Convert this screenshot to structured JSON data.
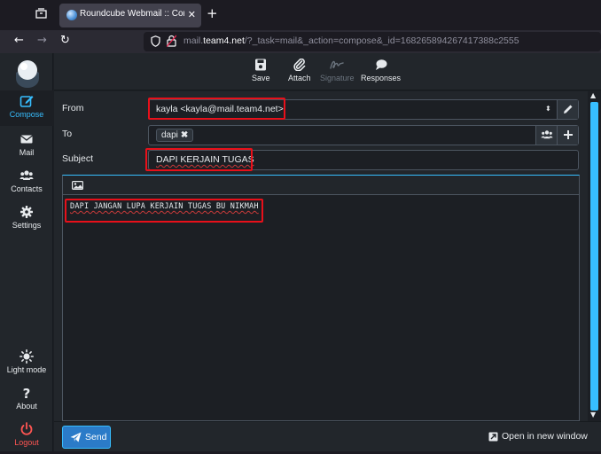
{
  "browser": {
    "tab_title": "Roundcube Webmail :: Compo",
    "url_host": "mail.team4.net",
    "url_path": "/?_task=mail&_action=compose&_id=168265894267417388c2555",
    "url_host_prefix": "mail.",
    "url_host_main": "team4.net"
  },
  "sidebar": {
    "items": [
      {
        "label": "Compose",
        "icon": "compose-icon"
      },
      {
        "label": "Mail",
        "icon": "mail-icon"
      },
      {
        "label": "Contacts",
        "icon": "contacts-icon"
      },
      {
        "label": "Settings",
        "icon": "gear-icon"
      },
      {
        "label": "Light mode",
        "icon": "sun-icon"
      },
      {
        "label": "About",
        "icon": "question-icon"
      },
      {
        "label": "Logout",
        "icon": "power-icon"
      }
    ]
  },
  "toolbar": {
    "save": "Save",
    "attach": "Attach",
    "signature": "Signature",
    "responses": "Responses"
  },
  "compose": {
    "from_label": "From",
    "from_value": "kayla <kayla@mail.team4.net>",
    "to_label": "To",
    "recipients": [
      "dapi"
    ],
    "subject_label": "Subject",
    "subject_value": "DAPI KERJAIN TUGAS",
    "body": "DAPI JANGAN LUPA KERJAIN TUGAS BU NIKMAH"
  },
  "footer": {
    "send": "Send",
    "open_new_window": "Open in new window"
  },
  "colors": {
    "accent": "#37beff",
    "highlight_box": "#e8101a",
    "logout": "#ff5552"
  }
}
